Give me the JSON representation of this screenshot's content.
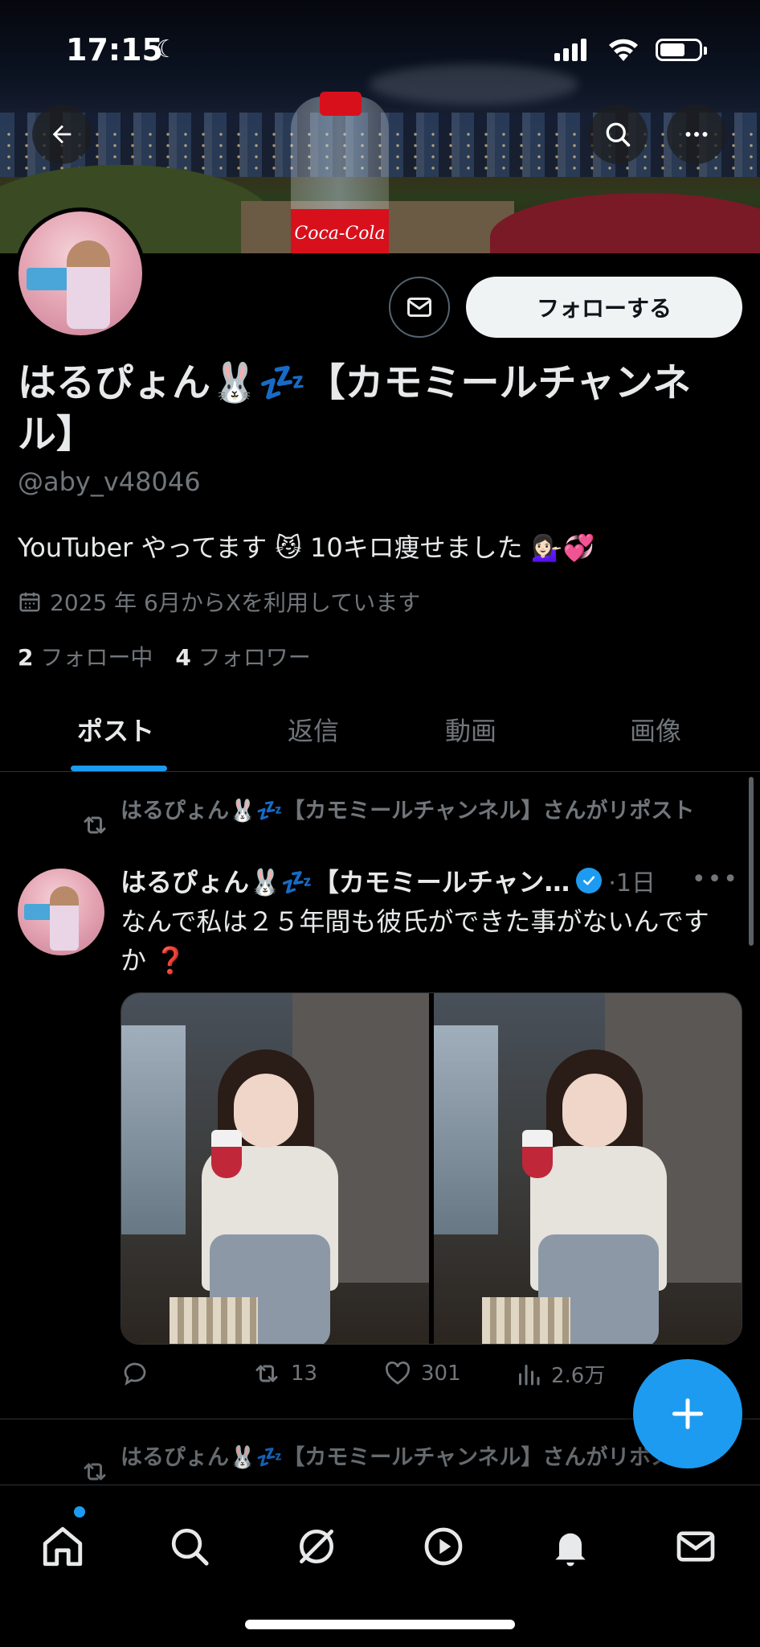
{
  "status_bar": {
    "time": "17:15"
  },
  "header": {
    "back_icon": "arrow-left-icon",
    "search_icon": "search-icon",
    "more_icon": "more-horizontal-icon"
  },
  "banner": {
    "bottle_label": "Coca-Cola"
  },
  "profile": {
    "follow_label": "フォローする",
    "name": "はるぴょん🐰💤【カモミールチャンネル】",
    "handle": "@aby_v48046",
    "bio": "YouTuber やってます 😼 10キロ痩せました 💁🏻‍♀️💞",
    "joined": "2025 年 6月からXを利用しています",
    "following_count": "2",
    "following_label": "フォロー中",
    "followers_count": "4",
    "followers_label": "フォロワー"
  },
  "tabs": [
    {
      "label": "ポスト",
      "active": true
    },
    {
      "label": "返信",
      "active": false
    },
    {
      "label": "動画",
      "active": false
    },
    {
      "label": "画像",
      "active": false
    }
  ],
  "posts": [
    {
      "repost_text": "はるぴょん🐰💤【カモミールチャンネル】さんがリポスト",
      "author": "はるぴょん🐰💤【カモミールチャン…",
      "time": "·1日",
      "text": "なんで私は２５年間も彼氏ができた事がないんですか ❓",
      "retweets": "13",
      "likes": "301",
      "views": "2.6万"
    },
    {
      "repost_text": "はるぴょん🐰💤【カモミールチャンネル】さんがリポスト"
    }
  ],
  "colors": {
    "accent": "#1d9bf0",
    "background": "#000000",
    "secondary_text": "#71767b",
    "primary_text": "#e7e9ea"
  }
}
